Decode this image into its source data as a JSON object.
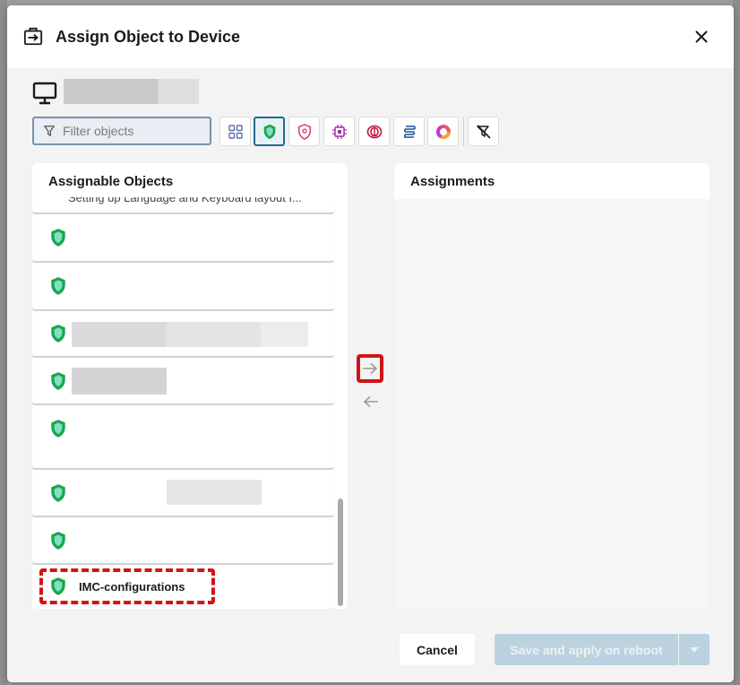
{
  "dialog": {
    "title": "Assign Object to Device",
    "close_icon": "close-icon",
    "header_icon": "assign-icon"
  },
  "device": {
    "icon": "monitor-icon"
  },
  "filter": {
    "placeholder": "Filter objects",
    "value": ""
  },
  "type_filters": [
    {
      "name": "all-types",
      "icon": "grid-icon",
      "active": false
    },
    {
      "name": "shield-type",
      "icon": "green-shield-icon",
      "active": true
    },
    {
      "name": "security-type",
      "icon": "pink-shield-icon",
      "active": false
    },
    {
      "name": "chip-type",
      "icon": "chip-icon",
      "active": false
    },
    {
      "name": "ring-type",
      "icon": "ring-icon",
      "active": false
    },
    {
      "name": "script-type",
      "icon": "script-icon",
      "active": false
    },
    {
      "name": "donut-type",
      "icon": "donut-icon",
      "active": false
    }
  ],
  "clear_filter_icon": "filter-clear-icon",
  "left_panel": {
    "title": "Assignable Objects",
    "partial_item_text": "Setting up Language and Keyboard layout f...",
    "items": [
      {
        "label": ""
      },
      {
        "label": ""
      },
      {
        "label": ""
      },
      {
        "label": ""
      },
      {
        "label": ""
      },
      {
        "label": ""
      },
      {
        "label": ""
      },
      {
        "label": "IMC-configurations"
      }
    ]
  },
  "right_panel": {
    "title": "Assignments"
  },
  "footer": {
    "cancel_label": "Cancel",
    "save_label": "Save and apply on reboot"
  },
  "colors": {
    "accent": "#1f6b93",
    "highlight": "#d11414",
    "shield_green": "#1aa64a",
    "save_disabled": "#bcd3df"
  }
}
